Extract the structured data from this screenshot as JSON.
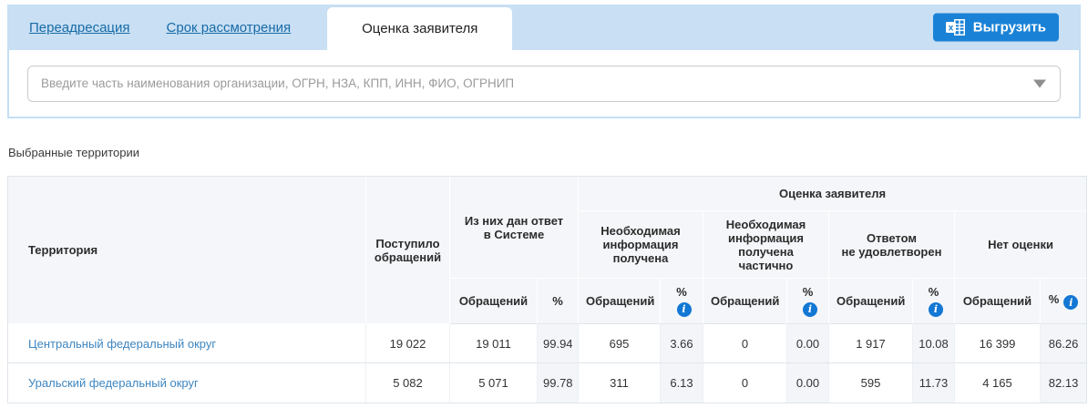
{
  "colors": {
    "tab_bar_bg": "#c8dff4",
    "accent_blue": "#1a82d6",
    "tab_link_blue": "#176ba6",
    "territory_link_blue": "#3e86c0",
    "info_icon_bg": "#1377d4",
    "table_header_bg": "#f4f6f9",
    "percent_column_bg": "#f3f5f9"
  },
  "tabs": [
    {
      "label": "Переадресация",
      "active": false
    },
    {
      "label": "Срок рассмотрения",
      "active": false
    },
    {
      "label": "Оценка заявителя",
      "active": true
    }
  ],
  "toolbar": {
    "export_label": "Выгрузить"
  },
  "search": {
    "placeholder": "Введите часть наименования организации, ОГРН, НЗА, КПП, ИНН, ФИО, ОГРНИП",
    "value": ""
  },
  "section": {
    "selected_territories_label": "Выбранные территории"
  },
  "icons": {
    "info_glyph": "i"
  },
  "table": {
    "headers": {
      "territory": "Территория",
      "received": "Поступило обращений",
      "answered_group": "Из них дан ответ\nв Системе",
      "rating_group": "Оценка заявителя",
      "subgroup_info_received": "Необходимая\nинформация\nполучена",
      "subgroup_info_partial": "Необходимая\nинформация\nполучена частично",
      "subgroup_not_satisfied": "Ответом\nне удовлетворен",
      "subgroup_no_rating": "Нет оценки",
      "appeals": "Обращений",
      "percent": "%"
    },
    "rows": [
      {
        "territory": "Центральный федеральный округ",
        "received": "19 022",
        "answered": "19 011",
        "answered_pct": "99.94",
        "info_received": "695",
        "info_received_pct": "3.66",
        "info_partial": "0",
        "info_partial_pct": "0.00",
        "not_satisfied": "1 917",
        "not_satisfied_pct": "10.08",
        "no_rating": "16 399",
        "no_rating_pct": "86.26"
      },
      {
        "territory": "Уральский федеральный округ",
        "received": "5 082",
        "answered": "5 071",
        "answered_pct": "99.78",
        "info_received": "311",
        "info_received_pct": "6.13",
        "info_partial": "0",
        "info_partial_pct": "0.00",
        "not_satisfied": "595",
        "not_satisfied_pct": "11.73",
        "no_rating": "4 165",
        "no_rating_pct": "82.13"
      }
    ]
  }
}
